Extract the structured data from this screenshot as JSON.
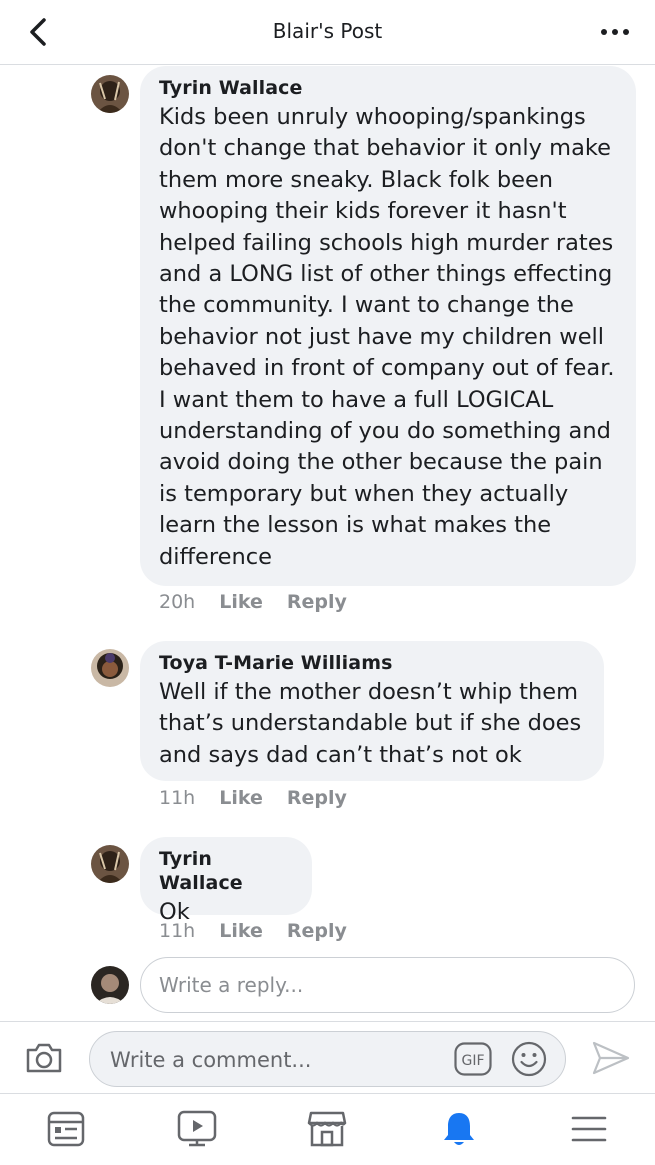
{
  "header": {
    "title": "Blair's Post"
  },
  "comments": [
    {
      "author": "Tyrin Wallace",
      "text": "Kids been unruly whooping/spankings don't change that behavior it only make them more sneaky. Black folk been whooping their kids forever it hasn't helped failing schools high murder rates and a LONG list of other things effecting the community. I want to change the behavior not just have my children well behaved in front of company out of fear. I want them to have a full LOGICAL understanding of you do something and avoid doing the other because the pain is temporary but when they actually learn the lesson is what makes the difference",
      "time": "20h",
      "like": "Like",
      "reply": "Reply"
    },
    {
      "author": "Toya T-Marie Williams",
      "text": "Well if the mother doesn’t whip them that’s understandable but if she does and says dad can’t that’s not ok",
      "time": "11h",
      "like": "Like",
      "reply": "Reply"
    },
    {
      "author": "Tyrin Wallace",
      "text": "Ok",
      "time": "11h",
      "like": "Like",
      "reply": "Reply"
    }
  ],
  "reply_box": {
    "placeholder": "Write a reply..."
  },
  "composer": {
    "placeholder": "Write a comment...",
    "gif_label": "GIF"
  },
  "tabs": [
    "news-feed",
    "watch",
    "marketplace",
    "notifications",
    "menu"
  ],
  "colors": {
    "accent": "#1877f2",
    "bubble": "#f0f2f5",
    "meta": "#8a8d91"
  }
}
